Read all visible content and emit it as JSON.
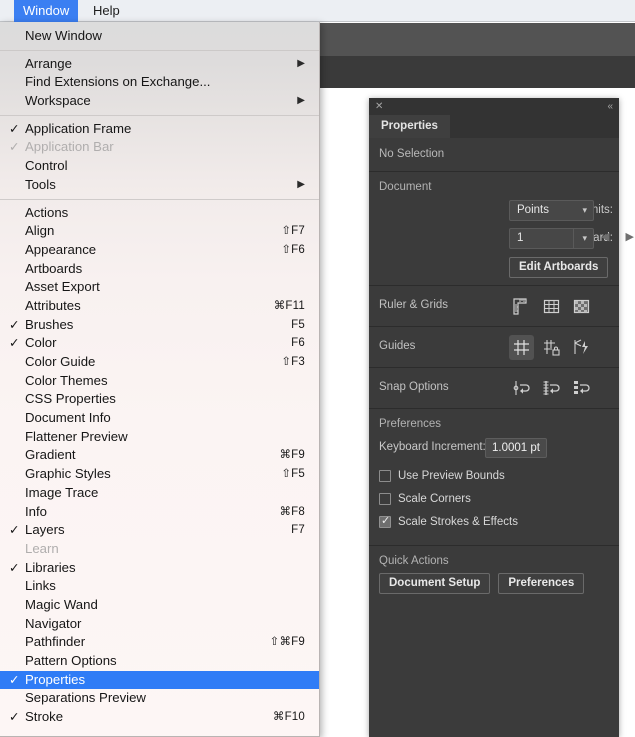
{
  "app": {
    "accent_blue": "#3b7ff2",
    "menu_highlight": "#2f7cf6",
    "panel_bg": "#3b3b3b"
  },
  "menubar": {
    "items": [
      {
        "label": "Window",
        "active": true
      },
      {
        "label": "Help",
        "active": false
      }
    ]
  },
  "window_menu": {
    "groups": [
      {
        "items": [
          {
            "label": "New Window",
            "check": "",
            "shortcut": "",
            "submenu": false,
            "disabled": false,
            "selected": false
          }
        ]
      },
      {
        "items": [
          {
            "label": "Arrange",
            "check": "",
            "shortcut": "",
            "submenu": true,
            "disabled": false,
            "selected": false
          },
          {
            "label": "Find Extensions on Exchange...",
            "check": "",
            "shortcut": "",
            "submenu": false,
            "disabled": false,
            "selected": false
          },
          {
            "label": "Workspace",
            "check": "",
            "shortcut": "",
            "submenu": true,
            "disabled": false,
            "selected": false
          }
        ]
      },
      {
        "items": [
          {
            "label": "Application Frame",
            "check": "✓",
            "shortcut": "",
            "submenu": false,
            "disabled": false,
            "selected": false
          },
          {
            "label": "Application Bar",
            "check": "✓",
            "shortcut": "",
            "submenu": false,
            "disabled": true,
            "selected": false
          },
          {
            "label": "Control",
            "check": "",
            "shortcut": "",
            "submenu": false,
            "disabled": false,
            "selected": false
          },
          {
            "label": "Tools",
            "check": "",
            "shortcut": "",
            "submenu": true,
            "disabled": false,
            "selected": false
          }
        ]
      },
      {
        "items": [
          {
            "label": "Actions",
            "check": "",
            "shortcut": "",
            "submenu": false,
            "disabled": false,
            "selected": false
          },
          {
            "label": "Align",
            "check": "",
            "shortcut": "⇧F7",
            "submenu": false,
            "disabled": false,
            "selected": false
          },
          {
            "label": "Appearance",
            "check": "",
            "shortcut": "⇧F6",
            "submenu": false,
            "disabled": false,
            "selected": false
          },
          {
            "label": "Artboards",
            "check": "",
            "shortcut": "",
            "submenu": false,
            "disabled": false,
            "selected": false
          },
          {
            "label": "Asset Export",
            "check": "",
            "shortcut": "",
            "submenu": false,
            "disabled": false,
            "selected": false
          },
          {
            "label": "Attributes",
            "check": "",
            "shortcut": "⌘F11",
            "submenu": false,
            "disabled": false,
            "selected": false
          },
          {
            "label": "Brushes",
            "check": "✓",
            "shortcut": "F5",
            "submenu": false,
            "disabled": false,
            "selected": false
          },
          {
            "label": "Color",
            "check": "✓",
            "shortcut": "F6",
            "submenu": false,
            "disabled": false,
            "selected": false
          },
          {
            "label": "Color Guide",
            "check": "",
            "shortcut": "⇧F3",
            "submenu": false,
            "disabled": false,
            "selected": false
          },
          {
            "label": "Color Themes",
            "check": "",
            "shortcut": "",
            "submenu": false,
            "disabled": false,
            "selected": false
          },
          {
            "label": "CSS Properties",
            "check": "",
            "shortcut": "",
            "submenu": false,
            "disabled": false,
            "selected": false
          },
          {
            "label": "Document Info",
            "check": "",
            "shortcut": "",
            "submenu": false,
            "disabled": false,
            "selected": false
          },
          {
            "label": "Flattener Preview",
            "check": "",
            "shortcut": "",
            "submenu": false,
            "disabled": false,
            "selected": false
          },
          {
            "label": "Gradient",
            "check": "",
            "shortcut": "⌘F9",
            "submenu": false,
            "disabled": false,
            "selected": false
          },
          {
            "label": "Graphic Styles",
            "check": "",
            "shortcut": "⇧F5",
            "submenu": false,
            "disabled": false,
            "selected": false
          },
          {
            "label": "Image Trace",
            "check": "",
            "shortcut": "",
            "submenu": false,
            "disabled": false,
            "selected": false
          },
          {
            "label": "Info",
            "check": "",
            "shortcut": "⌘F8",
            "submenu": false,
            "disabled": false,
            "selected": false
          },
          {
            "label": "Layers",
            "check": "✓",
            "shortcut": "F7",
            "submenu": false,
            "disabled": false,
            "selected": false
          },
          {
            "label": "Learn",
            "check": "",
            "shortcut": "",
            "submenu": false,
            "disabled": true,
            "selected": false
          },
          {
            "label": "Libraries",
            "check": "✓",
            "shortcut": "",
            "submenu": false,
            "disabled": false,
            "selected": false
          },
          {
            "label": "Links",
            "check": "",
            "shortcut": "",
            "submenu": false,
            "disabled": false,
            "selected": false
          },
          {
            "label": "Magic Wand",
            "check": "",
            "shortcut": "",
            "submenu": false,
            "disabled": false,
            "selected": false
          },
          {
            "label": "Navigator",
            "check": "",
            "shortcut": "",
            "submenu": false,
            "disabled": false,
            "selected": false
          },
          {
            "label": "Pathfinder",
            "check": "",
            "shortcut": "⇧⌘F9",
            "submenu": false,
            "disabled": false,
            "selected": false
          },
          {
            "label": "Pattern Options",
            "check": "",
            "shortcut": "",
            "submenu": false,
            "disabled": false,
            "selected": false
          },
          {
            "label": "Properties",
            "check": "✓",
            "shortcut": "",
            "submenu": false,
            "disabled": false,
            "selected": true
          },
          {
            "label": "Separations Preview",
            "check": "",
            "shortcut": "",
            "submenu": false,
            "disabled": false,
            "selected": false
          },
          {
            "label": "Stroke",
            "check": "✓",
            "shortcut": "⌘F10",
            "submenu": false,
            "disabled": false,
            "selected": false
          }
        ]
      }
    ]
  },
  "properties_panel": {
    "tab_label": "Properties",
    "close_glyph": "✕",
    "collapse_glyph": "«",
    "selection_state": "No Selection",
    "document": {
      "heading": "Document",
      "units_label": "Units:",
      "units_value": "Points",
      "artboard_label": "Artboard:",
      "artboard_value": "1",
      "edit_artboards_label": "Edit Artboards",
      "prev_arrow": "◀",
      "next_arrow": "▶"
    },
    "ruler_grids": {
      "label": "Ruler & Grids",
      "icons": [
        "show-rulers-icon",
        "show-grid-icon",
        "show-transparency-grid-icon"
      ]
    },
    "guides": {
      "label": "Guides",
      "icons": [
        "show-guides-icon",
        "lock-guides-icon",
        "smart-guides-icon"
      ],
      "active_index": 0
    },
    "snap_options": {
      "label": "Snap Options",
      "icons": [
        "snap-to-point-icon",
        "snap-to-grid-icon",
        "snap-to-pixel-icon"
      ]
    },
    "preferences": {
      "heading": "Preferences",
      "keyboard_increment_label": "Keyboard Increment:",
      "keyboard_increment_value": "1.0001 pt",
      "checkboxes": [
        {
          "label": "Use Preview Bounds",
          "checked": false
        },
        {
          "label": "Scale Corners",
          "checked": false
        },
        {
          "label": "Scale Strokes & Effects",
          "checked": true
        }
      ]
    },
    "quick_actions": {
      "heading": "Quick Actions",
      "buttons": [
        "Document Setup",
        "Preferences"
      ]
    }
  }
}
